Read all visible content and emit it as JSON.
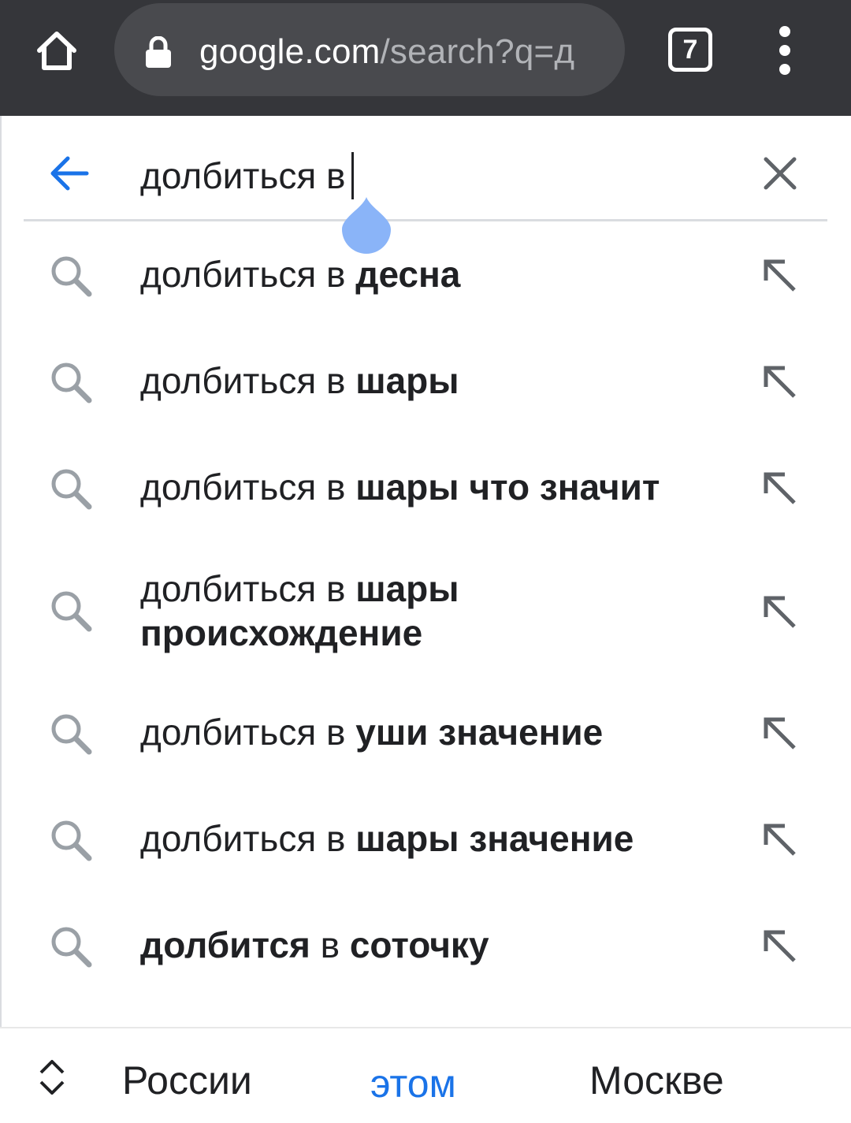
{
  "browser": {
    "url_host": "google.com",
    "url_rest": "/search?q=д",
    "tab_count": "7",
    "icons": [
      "home-icon",
      "lock-icon",
      "tabs-icon",
      "more-vert-icon"
    ]
  },
  "search": {
    "query": "долбиться в"
  },
  "suggestions": [
    {
      "plain": "долбиться в",
      "bold": "десна"
    },
    {
      "plain": "долбиться в",
      "bold": "шары"
    },
    {
      "plain": "долбиться в",
      "bold": "шары что значит"
    },
    {
      "plain": "долбиться в",
      "bold": "шары происхождение"
    },
    {
      "plain": "долбиться в",
      "bold": "уши значение"
    },
    {
      "plain": "долбиться в",
      "bold": "шары значение"
    },
    {
      "bold_start": "долбится",
      "plain": "в",
      "bold": "соточку"
    }
  ],
  "keyboard": {
    "words": [
      "России",
      "этом",
      "Москве"
    ]
  },
  "colors": {
    "toolbar": "#35363a",
    "omnibox": "#494a4e",
    "accent": "#1a73e8",
    "handle": "#8ab4f8",
    "icon_gray": "#9aa0a6"
  }
}
